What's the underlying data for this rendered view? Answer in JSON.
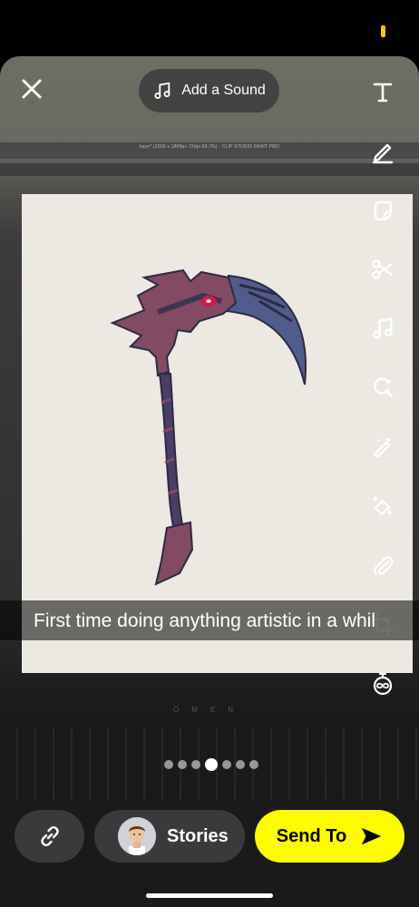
{
  "status_bar": {
    "battery_color": "#f5c518"
  },
  "photo": {
    "monitor_title": "kayn* (1500 x 1800px 72dpi 66.7%)  - CLIP STUDIO PAINT PRO",
    "keyboard_brand": "OMEN"
  },
  "header": {
    "close_icon": "close-icon",
    "sound_label": "Add a Sound"
  },
  "tools": [
    {
      "name": "text-tool",
      "icon": "text-icon"
    },
    {
      "name": "draw-tool",
      "icon": "pencil-icon"
    },
    {
      "name": "sticker-tool",
      "icon": "sticker-icon"
    },
    {
      "name": "scissors-tool",
      "icon": "scissors-icon"
    },
    {
      "name": "music-tool",
      "icon": "music-note-icon"
    },
    {
      "name": "lens-search-tool",
      "icon": "lens-search-icon"
    },
    {
      "name": "magic-wand-tool",
      "icon": "magic-wand-icon"
    },
    {
      "name": "magic-eraser-tool",
      "icon": "magic-eraser-icon"
    },
    {
      "name": "attachment-tool",
      "icon": "paperclip-icon"
    },
    {
      "name": "crop-tool",
      "icon": "crop-icon"
    },
    {
      "name": "timer-tool",
      "icon": "infinity-timer-icon"
    }
  ],
  "caption": {
    "text": "First time doing anything artistic in a whil"
  },
  "page_indicator": {
    "total": 7,
    "current": 4
  },
  "bottom": {
    "link_icon": "link-icon",
    "stories_label": "Stories",
    "send_label": "Send To",
    "accent": "#fffc00"
  }
}
